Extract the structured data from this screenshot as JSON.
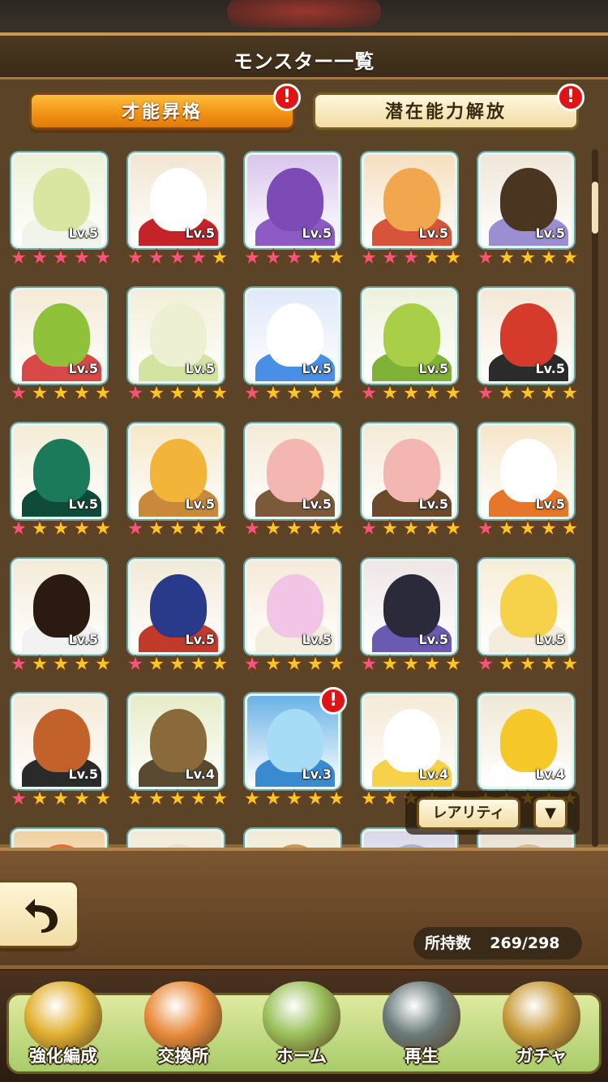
{
  "header": {
    "title": "モンスター一覧"
  },
  "tabs": [
    {
      "label": "才能昇格",
      "alert": "!"
    },
    {
      "label": "潜在能力解放",
      "alert": "!"
    }
  ],
  "monsters": [
    {
      "lv": "Lv.5",
      "pink": 5,
      "alert": false,
      "bg": "#eef2d8",
      "c1": "#d9e6a2",
      "c2": "#f0f4ea"
    },
    {
      "lv": "Lv.5",
      "pink": 4,
      "alert": false,
      "bg": "#f2e6d2",
      "c1": "#ffffff",
      "c2": "#c4232a"
    },
    {
      "lv": "Lv.5",
      "pink": 3,
      "alert": false,
      "bg": "#d8c6ec",
      "c1": "#7d4bb6",
      "c2": "#8d5ac6"
    },
    {
      "lv": "Lv.5",
      "pink": 3,
      "alert": false,
      "bg": "#f6dfbf",
      "c1": "#f2a64e",
      "c2": "#d6543a"
    },
    {
      "lv": "Lv.5",
      "pink": 1,
      "alert": false,
      "bg": "#efe7d9",
      "c1": "#4a3520",
      "c2": "#9c8ed2"
    },
    {
      "lv": "Lv.5",
      "pink": 1,
      "alert": false,
      "bg": "#f4ead6",
      "c1": "#8fc23a",
      "c2": "#d94848"
    },
    {
      "lv": "Lv.5",
      "pink": 1,
      "alert": false,
      "bg": "#f2efd8",
      "c1": "#edf0d2",
      "c2": "#d3e4a2"
    },
    {
      "lv": "Lv.5",
      "pink": 1,
      "alert": false,
      "bg": "#dfe9f8",
      "c1": "#ffffff",
      "c2": "#4a8fe6"
    },
    {
      "lv": "Lv.5",
      "pink": 1,
      "alert": false,
      "bg": "#eef2dc",
      "c1": "#a9cf48",
      "c2": "#7fb236"
    },
    {
      "lv": "Lv.5",
      "pink": 1,
      "alert": false,
      "bg": "#f4e8d6",
      "c1": "#d63a2a",
      "c2": "#2b2b2b"
    },
    {
      "lv": "Lv.5",
      "pink": 1,
      "alert": false,
      "bg": "#f4ecd6",
      "c1": "#1a7a5a",
      "c2": "#0f4a3a"
    },
    {
      "lv": "Lv.5",
      "pink": 1,
      "alert": false,
      "bg": "#f6e8c8",
      "c1": "#f2b53a",
      "c2": "#c88a3a"
    },
    {
      "lv": "Lv.5",
      "pink": 1,
      "alert": false,
      "bg": "#f4ead6",
      "c1": "#f4b6b0",
      "c2": "#7a5a3a"
    },
    {
      "lv": "Lv.5",
      "pink": 1,
      "alert": false,
      "bg": "#f4ead6",
      "c1": "#f4b6b0",
      "c2": "#6a4a2a"
    },
    {
      "lv": "Lv.5",
      "pink": 1,
      "alert": false,
      "bg": "#f6e6c8",
      "c1": "#ffffff",
      "c2": "#e6762a"
    },
    {
      "lv": "Lv.5",
      "pink": 1,
      "alert": false,
      "bg": "#f4ecd8",
      "c1": "#2a1a12",
      "c2": "#f2f2f2"
    },
    {
      "lv": "Lv.5",
      "pink": 1,
      "alert": false,
      "bg": "#f2ead8",
      "c1": "#2a3a8a",
      "c2": "#c23a2a"
    },
    {
      "lv": "Lv.5",
      "pink": 1,
      "alert": false,
      "bg": "#f6ead8",
      "c1": "#f2c4e6",
      "c2": "#f4eede"
    },
    {
      "lv": "Lv.5",
      "pink": 1,
      "alert": false,
      "bg": "#efe6e6",
      "c1": "#2a2a3a",
      "c2": "#6a5ab2"
    },
    {
      "lv": "Lv.5",
      "pink": 1,
      "alert": false,
      "bg": "#f6eed8",
      "c1": "#f6d24a",
      "c2": "#f4ecdc"
    },
    {
      "lv": "Lv.5",
      "pink": 1,
      "alert": false,
      "bg": "#f4ead8",
      "c1": "#c2622a",
      "c2": "#2a2a2a"
    },
    {
      "lv": "Lv.4",
      "pink": 0,
      "alert": false,
      "bg": "#e6ecc8",
      "c1": "#8a6a3a",
      "c2": "#5a4a32"
    },
    {
      "lv": "Lv.3",
      "pink": 0,
      "alert": true,
      "bg": "#6ab2e6",
      "c1": "#a6dcf6",
      "c2": "#3a8ad2"
    },
    {
      "lv": "Lv.4",
      "pink": 0,
      "alert": false,
      "bg": "#f4ead6",
      "c1": "#ffffff",
      "c2": "#f6d24a"
    },
    {
      "lv": "Lv.4",
      "pink": 0,
      "alert": false,
      "bg": "#efe8d6",
      "c1": "#f6c82a",
      "c2": "#ffffff"
    },
    {
      "lv": "",
      "pink": 0,
      "alert": false,
      "bg": "#f0d0a0",
      "c1": "#e0703a",
      "c2": "#b84a2a"
    },
    {
      "lv": "",
      "pink": 0,
      "alert": false,
      "bg": "#f2ead6",
      "c1": "#ece2c8",
      "c2": "#d8c8a8"
    },
    {
      "lv": "",
      "pink": 0,
      "alert": false,
      "bg": "#f2ead6",
      "c1": "#c89a5a",
      "c2": "#e8d8b8"
    },
    {
      "lv": "",
      "pink": 0,
      "alert": false,
      "bg": "#d8d8e8",
      "c1": "#b0b0c8",
      "c2": "#9090b0"
    },
    {
      "lv": "",
      "pink": 0,
      "alert": false,
      "bg": "#e8e0d0",
      "c1": "#d0c0a0",
      "c2": "#b0a080"
    }
  ],
  "filter": {
    "rarity_label": "レアリティ",
    "sort_icon": "▼"
  },
  "owned": {
    "label": "所持数",
    "value": "269/298"
  },
  "nav": [
    {
      "label": "強化編成",
      "icon": "enhance-icon",
      "color": "#e0b030"
    },
    {
      "label": "交換所",
      "icon": "shop-icon",
      "color": "#e88a3a"
    },
    {
      "label": "ホーム",
      "icon": "home-icon",
      "color": "#9ac05a"
    },
    {
      "label": "再生",
      "icon": "rebirth-icon",
      "color": "#6a7a7a"
    },
    {
      "label": "ガチャ",
      "icon": "gacha-icon",
      "color": "#c89a3a"
    }
  ],
  "colors": {
    "accent": "#f29416",
    "panel": "#5a4327",
    "pink_star": "#f2557f",
    "gold_star": "#f6c826",
    "alert": "#e01414"
  }
}
